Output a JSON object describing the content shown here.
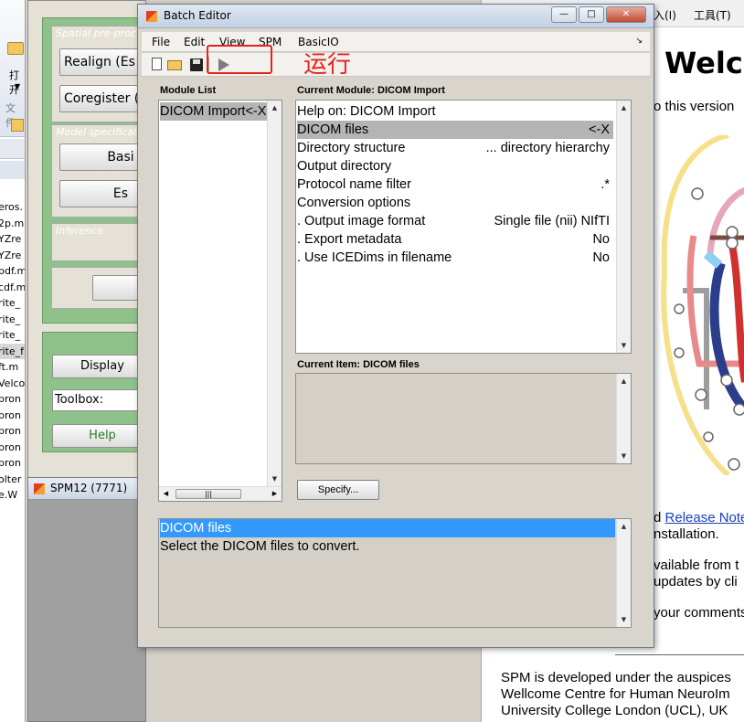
{
  "explorer": {
    "open_label": "打开",
    "file_label": "文件",
    "files": [
      "eros.",
      "2p.m",
      "YZre",
      "YZre",
      "pdf.m",
      "cdf.m",
      "rite_",
      "rite_",
      "rite_",
      "rite_f",
      "ft.m",
      "Velco",
      "pron",
      "pron",
      "pron",
      "pron",
      "pron",
      "olter",
      "e.W"
    ]
  },
  "spm_main": {
    "panels": [
      {
        "title": "Spatial pre-proc",
        "buttons": [
          "Realign (Es",
          "Coregister ("
        ]
      },
      {
        "title": "Model specificat",
        "buttons": [
          "Basi",
          "Es"
        ]
      },
      {
        "title": "Inference",
        "buttons": []
      }
    ],
    "display_label": "Display",
    "toolbox_label": "Toolbox:",
    "help_label": "Help"
  },
  "spm_graphics": {
    "title": "SPM12 (7771)"
  },
  "help_window": {
    "menu_items": [
      "入(I)",
      "工具(T)"
    ],
    "heading": "Welco",
    "intro_text": "o this version",
    "link_prefix": "d",
    "link_text": "Release Note",
    "line_installation": "nstallation.",
    "line_available": "vailable from t",
    "line_updates": "updates by cli",
    "line_comments": "your comments",
    "footer_line1": "SPM is developed under the auspices",
    "footer_line2": "Wellcome Centre for Human NeuroIm",
    "footer_line3": "University College London (UCL), UK"
  },
  "batch_editor": {
    "title": "Batch Editor",
    "menu": [
      "File",
      "Edit",
      "View",
      "SPM",
      "BasicIO"
    ],
    "module_list_label": "Module List",
    "modules": [
      "DICOM Import<-X"
    ],
    "current_module_label": "Current Module: DICOM Import",
    "current_module_rows": [
      {
        "label": "Help on: DICOM Import",
        "value": ""
      },
      {
        "label": "DICOM files",
        "value": "<-X"
      },
      {
        "label": "Directory structure",
        "value": "... directory hierarchy"
      },
      {
        "label": "Output directory",
        "value": ""
      },
      {
        "label": "Protocol name filter",
        "value": ".*"
      },
      {
        "label": "Conversion options",
        "value": ""
      },
      {
        "label": ". Output image format",
        "value": "Single file (nii) NIfTI"
      },
      {
        "label": ". Export metadata",
        "value": "No"
      },
      {
        "label": ". Use ICEDims in filename",
        "value": "No"
      }
    ],
    "selected_row": 1,
    "current_item_label": "Current Item: DICOM files",
    "specify_label": "Specify...",
    "help_selected": "DICOM files",
    "help_text": "Select the DICOM files to convert."
  },
  "annotation": {
    "text": "运行",
    "color": "#e8231c"
  },
  "colors": {
    "spm_green": "#8fc18a",
    "selection_blue": "#3399ff",
    "row_highlight": "#b4b4b4",
    "link": "#1a3fb8"
  }
}
